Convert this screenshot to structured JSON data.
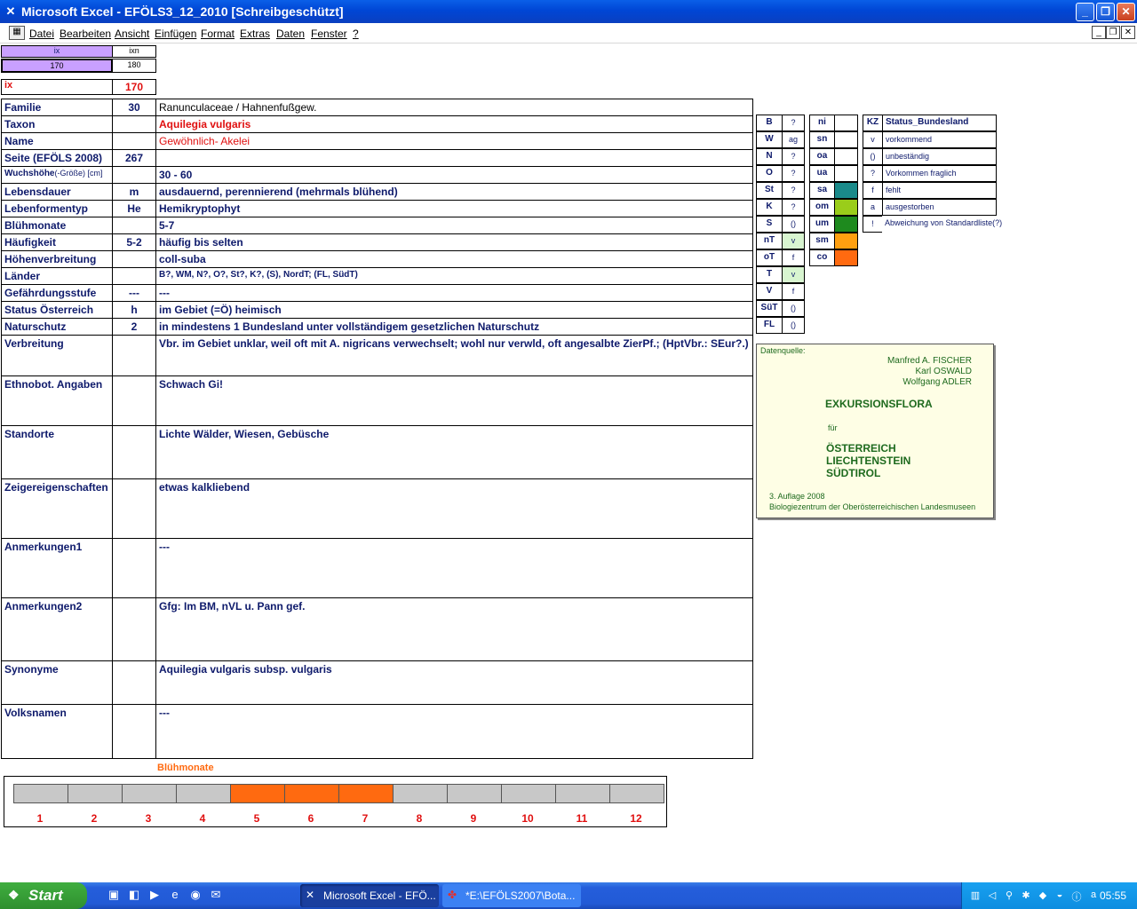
{
  "window": {
    "title": "Microsoft Excel - EFÖLS3_12_2010  [Schreibgeschützt]"
  },
  "menu": [
    "Datei",
    "Bearbeiten",
    "Ansicht",
    "Einfügen",
    "Format",
    "Extras",
    "Daten",
    "Fenster",
    "?"
  ],
  "top": {
    "ix_head": "ix",
    "ixn_head": "ixn",
    "ix_val": "170",
    "ixn_val": "180",
    "ix_label": "ix",
    "ix_big": "170"
  },
  "fields": [
    {
      "label": "Familie",
      "code": "30",
      "value": "Ranunculaceae  /  Hahnenfußgew."
    },
    {
      "label": "Taxon",
      "code": "",
      "value": "Aquilegia vulgaris"
    },
    {
      "label": "Name",
      "code": "",
      "value": "Gewöhnlich- Akelei"
    },
    {
      "label": "Seite (EFÖLS 2008)",
      "code": "267",
      "value": ""
    },
    {
      "label": "Wuchshöhe",
      "label_suffix": "(-Größe) [cm]",
      "code": "",
      "value": " 30 - 60"
    },
    {
      "label": "Lebensdauer",
      "code": "m",
      "value": "ausdauernd, perennierend (mehrmals blühend)"
    },
    {
      "label": "Lebenformentyp",
      "code": "He",
      "value": "Hemikryptophyt"
    },
    {
      "label": "Blühmonate",
      "code": "",
      "value": " 5-7"
    },
    {
      "label": "Häufigkeit",
      "code": "5-2",
      "value": "häufig bis selten"
    },
    {
      "label": "Höhenverbreitung",
      "code": "",
      "value": "coll-suba"
    },
    {
      "label": "Länder",
      "code": "",
      "value": "B?, WM, N?, O?, St?, K?, (S), NordT; (FL, SüdT)"
    },
    {
      "label": "Gefährdungsstufe",
      "code": "---",
      "value": "  ---"
    },
    {
      "label": "Status Österreich",
      "code": "h",
      "value": "im Gebiet (=Ö) heimisch"
    },
    {
      "label": "Naturschutz",
      "code": "2",
      "value": "in mindestens 1 Bundesland unter vollständigem gesetzlichen Naturschutz"
    },
    {
      "label": "Verbreitung",
      "code": "",
      "value": "Vbr. im Gebiet unklar, weil oft mit A. nigricans verwechselt; wohl nur verwld, oft angesalbte ZierPf.; (HptVbr.: SEur?.)"
    },
    {
      "label": "Ethnobot. Angaben",
      "code": "",
      "value": "Schwach Gi!"
    },
    {
      "label": "Standorte",
      "code": "",
      "value": "Lichte Wälder, Wiesen, Gebüsche"
    },
    {
      "label": "Zeigereigenschaften",
      "code": "",
      "value": "etwas kalkliebend"
    },
    {
      "label": "Anmerkungen1",
      "code": "",
      "value": "---"
    },
    {
      "label": "Anmerkungen2",
      "code": "",
      "value": "Gfg: Im BM, nVL u. Pann gef."
    },
    {
      "label": "Synonyme",
      "code": "",
      "value": "Aquilegia vulgaris subsp. vulgaris"
    },
    {
      "label": "Volksnamen",
      "code": "",
      "value": "---"
    }
  ],
  "states": [
    {
      "code": "B",
      "v": "?"
    },
    {
      "code": "W",
      "v": "ag"
    },
    {
      "code": "N",
      "v": "?"
    },
    {
      "code": "O",
      "v": "?"
    },
    {
      "code": "St",
      "v": "?"
    },
    {
      "code": "K",
      "v": "?"
    },
    {
      "code": "S",
      "v": "()"
    },
    {
      "code": "nT",
      "v": "v"
    },
    {
      "code": "oT",
      "v": "f"
    },
    {
      "code": "T",
      "v": "v"
    },
    {
      "code": "V",
      "v": "f"
    },
    {
      "code": "SüT",
      "v": "()"
    },
    {
      "code": "FL",
      "v": "()"
    }
  ],
  "altitude": [
    {
      "code": "ni",
      "color": ""
    },
    {
      "code": "sn",
      "color": ""
    },
    {
      "code": "oa",
      "color": ""
    },
    {
      "code": "ua",
      "color": ""
    },
    {
      "code": "sa",
      "color": "#1a8a8a"
    },
    {
      "code": "om",
      "color": "#9acd1a"
    },
    {
      "code": "um",
      "color": "#1e8a1e"
    },
    {
      "code": "sm",
      "color": "#ffa010"
    },
    {
      "code": "co",
      "color": "#ff6a10"
    }
  ],
  "status": {
    "kz_head": "KZ",
    "name_head": "Status_Bundesland",
    "rows": [
      {
        "kz": "v",
        "text": "vorkommend"
      },
      {
        "kz": "()",
        "text": "unbeständig"
      },
      {
        "kz": "?",
        "text": "Vorkommen fraglich"
      },
      {
        "kz": "f",
        "text": "fehlt"
      },
      {
        "kz": "a",
        "text": "ausgestorben"
      },
      {
        "kz": "!",
        "text": "Abweichung von Standardliste(?)"
      }
    ]
  },
  "source": {
    "label": "Datenquelle:",
    "author1": "Manfred A. FISCHER",
    "author2": "Karl OSWALD",
    "author3": "Wolfgang ADLER",
    "title": "EXKURSIONSFLORA",
    "fuer": "für",
    "c1": "ÖSTERREICH",
    "c2": "LIECHTENSTEIN",
    "c3": "SÜDTIROL",
    "edition": "3. Auflage 2008",
    "publisher": "Biologiezentrum der Oberösterreichischen Landesmuseen"
  },
  "bloom": {
    "title": "Blühmonate",
    "months": [
      "1",
      "2",
      "3",
      "4",
      "5",
      "6",
      "7",
      "8",
      "9",
      "10",
      "11",
      "12"
    ],
    "active": [
      5,
      6,
      7
    ],
    "active_color": "#ff6a10"
  },
  "taskbar": {
    "start": "Start",
    "task1": "Microsoft Excel - EFÖ...",
    "task2": "*E:\\EFÖLS2007\\Bota...",
    "clock": "05:55"
  }
}
